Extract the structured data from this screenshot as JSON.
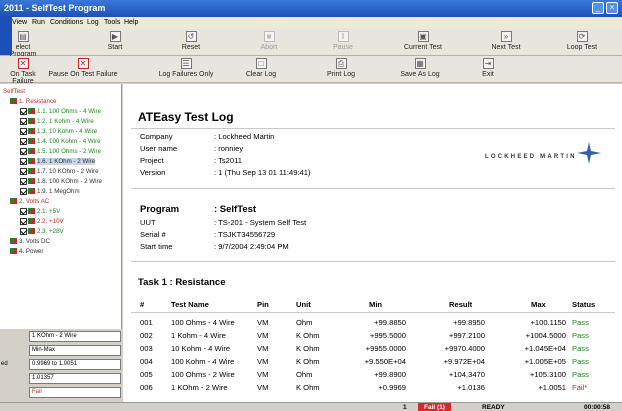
{
  "window": {
    "title": "2011 - SelfTest Program"
  },
  "menu": [
    "m",
    "View",
    "Run",
    "Conditions",
    "Log",
    "Tools",
    "Help"
  ],
  "toolbar1": [
    {
      "label": "elect Program",
      "icon": "open-folder-icon",
      "enabled": true
    },
    {
      "label": "Start",
      "icon": "start-icon",
      "enabled": true
    },
    {
      "label": "Reset",
      "icon": "reset-icon",
      "enabled": true
    },
    {
      "label": "Abort",
      "icon": "abort-icon",
      "enabled": false
    },
    {
      "label": "Pause",
      "icon": "pause-icon",
      "enabled": false
    },
    {
      "label": "Current Test",
      "icon": "current-test-icon",
      "enabled": true
    },
    {
      "label": "Next Test",
      "icon": "next-test-icon",
      "enabled": true
    },
    {
      "label": "Loop Test",
      "icon": "loop-test-icon",
      "enabled": true
    }
  ],
  "toolbar2": [
    {
      "label": "On Task Failure",
      "icon": "task-failure-icon"
    },
    {
      "label": "Pause On Test Failure",
      "icon": "pause-on-failure-icon"
    },
    {
      "label": "Log Failures Only",
      "icon": "log-failures-icon"
    },
    {
      "label": "Clear Log",
      "icon": "clear-log-icon"
    },
    {
      "label": "Print Log",
      "icon": "print-icon"
    },
    {
      "label": "Save As Log",
      "icon": "save-icon"
    },
    {
      "label": "Exit",
      "icon": "exit-icon"
    }
  ],
  "tree": {
    "root": "SelfTest",
    "nodes": [
      {
        "label": "1. Resistance",
        "level": 1,
        "color": "red"
      },
      {
        "label": "1.1. 100 Ohms - 4 Wire",
        "level": 2,
        "color": "green"
      },
      {
        "label": "1.2. 1 Kohm - 4 Wire",
        "level": 2,
        "color": "green"
      },
      {
        "label": "1.3. 10 Kohm - 4 Wire",
        "level": 2,
        "color": "green"
      },
      {
        "label": "1.4. 100 Kohm - 4 Wire",
        "level": 2,
        "color": "green"
      },
      {
        "label": "1.5. 100 Ohms - 2 Wire",
        "level": 2,
        "color": "green"
      },
      {
        "label": "1.6. 1 KOhm - 2 Wire",
        "level": 2,
        "color": "grey",
        "selected": true
      },
      {
        "label": "1.7. 10 KOhm - 2 Wire",
        "level": 2,
        "color": "grey"
      },
      {
        "label": "1.8. 100 KOhm - 2 Wire",
        "level": 2,
        "color": "grey"
      },
      {
        "label": "1.9. 1 MegOhm",
        "level": 2,
        "color": "grey"
      },
      {
        "label": "2. Volts AC",
        "level": 1,
        "color": "red"
      },
      {
        "label": "2.1. +5V",
        "level": 2,
        "color": "green"
      },
      {
        "label": "2.2. +10V",
        "level": 2,
        "color": "red"
      },
      {
        "label": "2.3. +28V",
        "level": 2,
        "color": "green"
      },
      {
        "label": "3. Volts DC",
        "level": 1,
        "color": "grey"
      },
      {
        "label": "4. Power",
        "level": 1,
        "color": "grey"
      }
    ]
  },
  "current_test": {
    "name": "1 KOhm - 2 Wire",
    "mode": "Min-Max",
    "range_label": "ed",
    "range": "0.9969 to 1.0051",
    "value": "1.01357",
    "status": "Fail"
  },
  "log": {
    "title": "ATEasy Test Log",
    "info": [
      {
        "key": "Company",
        "value": ": Lockheed Martin"
      },
      {
        "key": "User name",
        "value": ": ronniey"
      },
      {
        "key": "Project",
        "value": ": Ts2011"
      },
      {
        "key": "Version",
        "value": ": 1 (Thu Sep 13 01 11:49:41)"
      }
    ],
    "logo_text": "LOCKHEED MARTIN",
    "program_title": "Program",
    "program_name": ": SelfTest",
    "program_info": [
      {
        "key": "UUT",
        "value": ": TS-201 - System Self Test"
      },
      {
        "key": "Serial #",
        "value": ": TSJKT34556729"
      },
      {
        "key": "Start time",
        "value": ": 9/7/2004 2:49:04 PM"
      }
    ],
    "task_title": "Task 1 : Resistance",
    "columns": [
      "#",
      "Test Name",
      "Pin",
      "Unit",
      "Min",
      "Result",
      "Max",
      "Status"
    ],
    "rows": [
      [
        "001",
        "100 Ohms - 4 Wire",
        "VM",
        "Ohm",
        "+99.8850",
        "+99.8950",
        "+100.1150",
        "Pass"
      ],
      [
        "002",
        "1 Kohm - 4 Wire",
        "VM",
        "K Ohm",
        "+995.5000",
        "+997.2100",
        "+1004.5000",
        "Pass"
      ],
      [
        "003",
        "10 Kohm - 4 Wire",
        "VM",
        "K Ohm",
        "+9955.0000",
        "+9970.4000",
        "+1.045E+04",
        "Pass"
      ],
      [
        "004",
        "100 Kohm - 4 Wire",
        "VM",
        "K Ohm",
        "+9.550E+04",
        "+9.972E+04",
        "+1.005E+05",
        "Pass"
      ],
      [
        "005",
        "100 Ohms - 2 Wire",
        "VM",
        "Ohm",
        "+99.8900",
        "+104.3470",
        "+105.3100",
        "Pass"
      ],
      [
        "006",
        "1 KOhm - 2 Wire",
        "VM",
        "K Ohm",
        "+0.9969",
        "+1.0136",
        "+1.0051",
        "Fail*"
      ]
    ]
  },
  "status": {
    "page": "1",
    "fail": "Fail (1)",
    "state": "READY",
    "time": "00:00:58"
  }
}
